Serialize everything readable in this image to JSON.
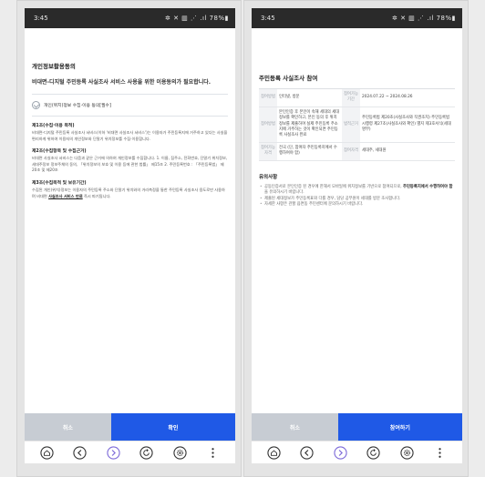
{
  "status": {
    "time": "3:45",
    "icons": "✲ ✕ ▥ ⋰ .ıl 78%▮"
  },
  "left": {
    "title": "개인정보활용동의",
    "subtitle": "비대면-디지털 주민등록 사실조사 서비스 사용을 위한 이용동의가 필요합니다.",
    "agree_label": "개인(위치)정보 수집·이용 동의[필수]",
    "sections": [
      {
        "title": "제1조(수집·이용 목적)",
        "body": "비대면-디지털 주민등록 사실조사 서비스(이하 '비대면 사실조사 서비스')는 이용자가 주민등록지에 거주하고 있다는 사실을 편리하게 위하여 이용자의 개인정보와 단말기 위치정보를 수집·이용합니다."
      },
      {
        "title": "제2조(수집항목 및 수집근거)",
        "body": "비대면 사실조사 서비스는 다음과 같은 근거에 의하여 개인정보를 수집합니다. 1. 이름, 집주소, 전화번호, 단말기 위치정보, 세대주정보 정보주체의 동의, 「위치정보의 보호 및 이용 등에 관한 법률」 제15조 2. 주민등록번호 : 「주민등록법」 제20조 및 제20조"
      },
      {
        "title": "제3조(수집목적 및 보유기간)",
        "body": "수집된 개인(위치)정보는 이용자의 주민등록 주소와 단말기 위치와의 거리측정을 통한 주민등록 사실조사 용도로만 사용하며 비대면 ",
        "body_bold": "사실조사 서비스 만료",
        "body_tail": " 즉시 파기됩니다."
      }
    ],
    "cancel_label": "취소",
    "confirm_label": "확인"
  },
  "right": {
    "title": "주민등록 사실조사 참여",
    "table": {
      "row1": {
        "h1": "참여방법",
        "v1": "인터넷, 방문",
        "h2": "참여가능기간",
        "v2": "2024.07.22 ~ 2024.08.26"
      },
      "row2": {
        "h1": "참여방법",
        "v1": "본인인증 후 본인이 속해 세대의 세대정보를 확인하고, 본인 동의 후 위치정보를 제출하여 실제 주민등록 주소지에 거주하는 것이 확인되면 주민등록 사실조사 완료",
        "h2": "법적근거",
        "v2": "주민등록법 제20조(사실조사와 직권조치) 주민등록법 시행령 제27조(사실조사와 확인) 별지 제3호서식(세대명부)"
      },
      "row3": {
        "h1": "참여가능자격",
        "v1": "전국 (단, 참여자 주민등록지에서 수행하여야 함)",
        "h2": "참여자격",
        "v2": "세대주, 세대원"
      }
    },
    "notice_title": "유의사항",
    "notices": [
      {
        "pre": "공동인증서로 본인인증 된 경우에 한해서 모바일에 위치정보를 기반으로 참여되므로, ",
        "bold": "주민등록지에서 수행하여야 함",
        "post": "을 유의하시기 바랍니다."
      },
      {
        "pre": "제출된 세대정보가 주민등록표와 다를 경우, 담당 공무원이 세대를 방문 조사합니다.",
        "bold": "",
        "post": ""
      },
      {
        "pre": "자세한 사항은 관할 읍면동 주민센터에 문의하시기 바랍니다.",
        "bold": "",
        "post": ""
      }
    ],
    "cancel_label": "취소",
    "join_label": "참여하기"
  },
  "colors": {
    "primary": "#1f59e6",
    "cancel": "#c7ccd3",
    "statusbar": "#2a2a2a"
  },
  "nav_icons": [
    "home-icon",
    "back-icon",
    "forward-icon",
    "refresh-icon",
    "settings-icon",
    "more-icon"
  ]
}
